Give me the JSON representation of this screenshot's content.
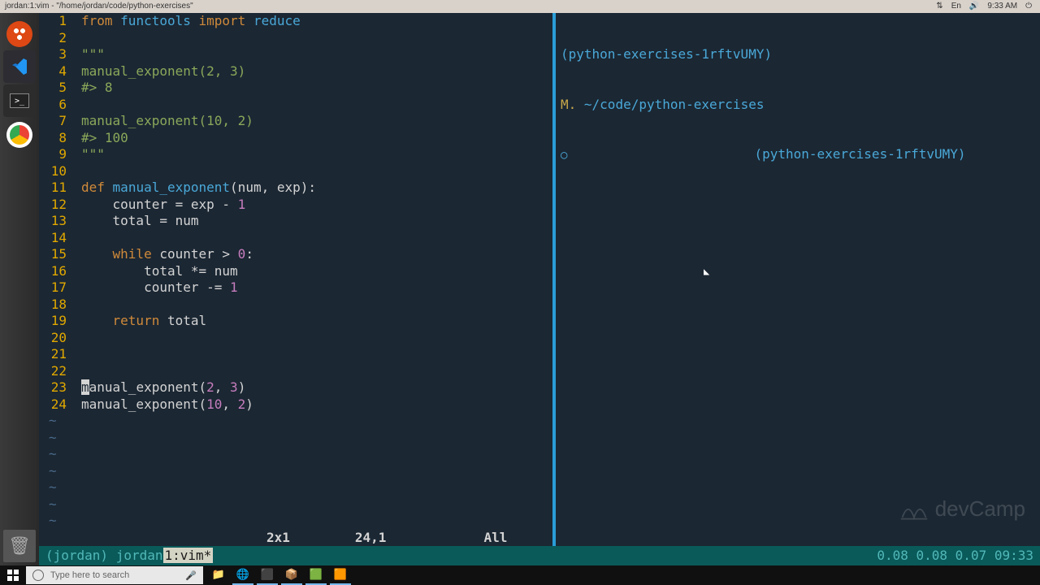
{
  "window": {
    "title": "jordan:1:vim - \"/home/jordan/code/python-exercises\""
  },
  "tray": {
    "lang": "En",
    "time": "9:33 AM"
  },
  "code": {
    "lines": [
      {
        "n": 1,
        "spans": [
          {
            "c": "kw",
            "t": "from"
          },
          {
            "c": "",
            "t": " "
          },
          {
            "c": "fn",
            "t": "functools"
          },
          {
            "c": "",
            "t": " "
          },
          {
            "c": "kw",
            "t": "import"
          },
          {
            "c": "",
            "t": " "
          },
          {
            "c": "fn",
            "t": "reduce"
          }
        ]
      },
      {
        "n": 2,
        "spans": []
      },
      {
        "n": 3,
        "spans": [
          {
            "c": "str",
            "t": "\"\"\""
          }
        ]
      },
      {
        "n": 4,
        "spans": [
          {
            "c": "str",
            "t": "manual_exponent(2, 3)"
          }
        ]
      },
      {
        "n": 5,
        "spans": [
          {
            "c": "str",
            "t": "#> 8"
          }
        ]
      },
      {
        "n": 6,
        "spans": []
      },
      {
        "n": 7,
        "spans": [
          {
            "c": "str",
            "t": "manual_exponent(10, 2)"
          }
        ]
      },
      {
        "n": 8,
        "spans": [
          {
            "c": "str",
            "t": "#> 100"
          }
        ]
      },
      {
        "n": 9,
        "spans": [
          {
            "c": "str",
            "t": "\"\"\""
          }
        ]
      },
      {
        "n": 10,
        "spans": []
      },
      {
        "n": 11,
        "spans": [
          {
            "c": "kw",
            "t": "def"
          },
          {
            "c": "",
            "t": " "
          },
          {
            "c": "fn",
            "t": "manual_exponent"
          },
          {
            "c": "",
            "t": "(num, exp):"
          }
        ]
      },
      {
        "n": 12,
        "spans": [
          {
            "c": "",
            "t": "    counter = exp - "
          },
          {
            "c": "num",
            "t": "1"
          }
        ]
      },
      {
        "n": 13,
        "spans": [
          {
            "c": "",
            "t": "    total = num"
          }
        ]
      },
      {
        "n": 14,
        "spans": []
      },
      {
        "n": 15,
        "spans": [
          {
            "c": "",
            "t": "    "
          },
          {
            "c": "kw",
            "t": "while"
          },
          {
            "c": "",
            "t": " counter > "
          },
          {
            "c": "num",
            "t": "0"
          },
          {
            "c": "",
            "t": ":"
          }
        ]
      },
      {
        "n": 16,
        "spans": [
          {
            "c": "",
            "t": "        total *= num"
          }
        ]
      },
      {
        "n": 17,
        "spans": [
          {
            "c": "",
            "t": "        counter -= "
          },
          {
            "c": "num",
            "t": "1"
          }
        ]
      },
      {
        "n": 18,
        "spans": []
      },
      {
        "n": 19,
        "spans": [
          {
            "c": "",
            "t": "    "
          },
          {
            "c": "kw",
            "t": "return"
          },
          {
            "c": "",
            "t": " total"
          }
        ]
      },
      {
        "n": 20,
        "spans": []
      },
      {
        "n": 21,
        "spans": []
      },
      {
        "n": 22,
        "spans": []
      },
      {
        "n": 23,
        "spans": [
          {
            "c": "cursor",
            "t": "m"
          },
          {
            "c": "",
            "t": "anual_exponent("
          },
          {
            "c": "num",
            "t": "2"
          },
          {
            "c": "",
            "t": ", "
          },
          {
            "c": "num",
            "t": "3"
          },
          {
            "c": "",
            "t": ")"
          }
        ]
      },
      {
        "n": 24,
        "spans": [
          {
            "c": "",
            "t": "manual_exponent("
          },
          {
            "c": "num",
            "t": "10"
          },
          {
            "c": "",
            "t": ", "
          },
          {
            "c": "num",
            "t": "2"
          },
          {
            "c": "",
            "t": ")"
          }
        ]
      }
    ],
    "tildes": 7
  },
  "status": {
    "col_indicator": "2x1",
    "position": "24,1",
    "scroll": "All"
  },
  "right_pane": {
    "branch": "(python-exercises-1rftvUMY)",
    "modified": "M.",
    "cwd": "~/code/python-exercises",
    "prompt_sym": "○",
    "prompt_env": "(python-exercises-1rftvUMY)"
  },
  "tmux": {
    "session_prefix": "(jordan) jordan",
    "active_window": "1:vim*",
    "right": "0.08 0.08 0.07 09:33"
  },
  "devcamp": {
    "text": "devCamp"
  },
  "taskbar": {
    "search_placeholder": "Type here to search"
  }
}
